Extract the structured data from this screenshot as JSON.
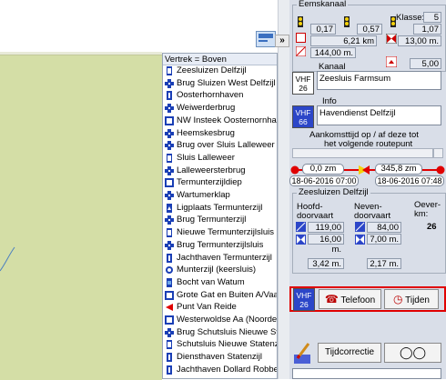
{
  "list": {
    "header": "Vertrek = Boven",
    "items": [
      {
        "label": "Zeesluizen Delfzijl",
        "icon": "lock-icon"
      },
      {
        "label": "Brug Sluizen West Delfzijl",
        "icon": "bridge-icon"
      },
      {
        "label": "Oosterhornhaven",
        "icon": "harbour-icon"
      },
      {
        "label": "Weiwerderbrug",
        "icon": "bridge-icon"
      },
      {
        "label": "NW Insteek Oosternornhaven",
        "icon": "junction-icon"
      },
      {
        "label": "Heemskesbrug",
        "icon": "bridge-icon"
      },
      {
        "label": "Brug over Sluis Lalleweer",
        "icon": "bridge-icon"
      },
      {
        "label": "Sluis Lalleweer",
        "icon": "lock-icon"
      },
      {
        "label": "Lalleweersterbrug",
        "icon": "bridge-icon"
      },
      {
        "label": "Termunterzijldiep",
        "icon": "junction-icon"
      },
      {
        "label": "Wartumerklap",
        "icon": "bridge-icon"
      },
      {
        "label": "Ligplaats Termunterzijl",
        "icon": "mooring-icon"
      },
      {
        "label": "Brug Termunterzijl",
        "icon": "bridge-icon"
      },
      {
        "label": "Nieuwe Termunterzijlsluis",
        "icon": "lock-icon"
      },
      {
        "label": "Brug Termunterzijlsluis",
        "icon": "bridge-icon"
      },
      {
        "label": "Jachthaven Termunterzijl",
        "icon": "harbour-icon"
      },
      {
        "label": "Munterzijl (keersluis)",
        "icon": "weir-icon"
      },
      {
        "label": "Bocht van Watum",
        "icon": "bend-icon"
      },
      {
        "label": "Grote Gat en Buiten A/Vaarw",
        "icon": "junction-icon"
      },
      {
        "label": "Punt Van Reide",
        "icon": "point-icon"
      },
      {
        "label": "Westerwoldse Aa (Noordelijk",
        "icon": "junction-icon"
      },
      {
        "label": "Brug Schutsluis Nieuwe State",
        "icon": "bridge-icon"
      },
      {
        "label": "Schutsluis Nieuwe Statenzijl",
        "icon": "lock-icon"
      },
      {
        "label": "Diensthaven Statenzijl",
        "icon": "harbour-icon"
      },
      {
        "label": "Jachthaven Dollard Robben",
        "icon": "harbour-icon"
      }
    ]
  },
  "panel": {
    "top_group_title": "Eemskanaal",
    "klasse_label": "Klasse:",
    "klasse_value": "5",
    "dim1": "0,17",
    "dim2": "0,57",
    "dim3": "1,07",
    "dim4": "6,21 km",
    "dim5": "13,00 m.",
    "dim6": "144,00 m.",
    "dim7": "5,00 m.",
    "vhf_label": "VHF",
    "kanaal_label": "Kanaal",
    "kanaal_vhf_channel": "26",
    "kanaal_value": "Zeesluis Farmsum",
    "info_label": "Info",
    "info_vhf_channel": "66",
    "info_value": "Havendienst Delfzijl",
    "aankomst_line1": "Aankomsttijd op / af deze tot",
    "aankomst_line2": "het volgende routepunt",
    "dist_left": "0,0 zm",
    "dist_right": "345,8 zm",
    "time_left": "18-06-2016 07:00",
    "time_right": "18-06-2016 07:48",
    "sub_group_title": "Zeesluizen Delfzijl",
    "hoofd_label1": "Hoofd-",
    "hoofd_label2": "doorvaart",
    "neven_label1": "Neven-",
    "neven_label2": "doorvaart",
    "oever_label1": "Oever-",
    "oever_label2": "km:",
    "oever_value": "26",
    "h_width": "119,00 m.",
    "h_height": "16,00 m.",
    "h_depth": "3,42 m.",
    "n_width": "84,00 m.",
    "n_height": "7,00 m.",
    "n_depth": "2,17 m.",
    "bottom_vhf_channel": "26",
    "telefoon_label": "Telefoon",
    "tijden_label": "Tijden",
    "tijdcorrectie_label": "Tijdcorrectie"
  },
  "colors": {
    "accent_red": "#e00000",
    "vhf_blue": "#2c46c8",
    "panel_bg": "#d9dee8",
    "map_land": "#d4dea6",
    "route_yellow": "#f5d20a"
  }
}
